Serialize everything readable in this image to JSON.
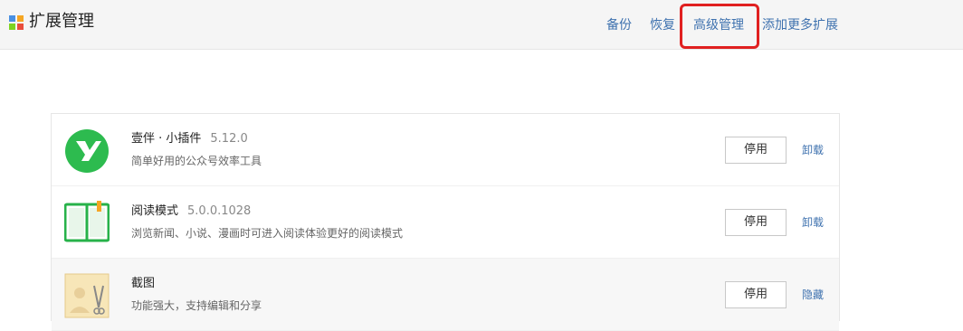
{
  "header": {
    "title": "扩展管理",
    "nav": [
      "备份",
      "恢复",
      "高级管理",
      "添加更多扩展"
    ]
  },
  "extensions": [
    {
      "name": "壹伴 · 小插件",
      "version": "5.12.0",
      "description": "简单好用的公众号效率工具",
      "toggle_label": "停用",
      "action_label": "卸载",
      "icon": "yiban-logo-icon"
    },
    {
      "name": "阅读模式",
      "version": "5.0.0.1028",
      "description": "浏览新闻、小说、漫画时可进入阅读体验更好的阅读模式",
      "toggle_label": "停用",
      "action_label": "卸载",
      "icon": "book-icon"
    },
    {
      "name": "截图",
      "version": "",
      "description": "功能强大，支持编辑和分享",
      "toggle_label": "停用",
      "action_label": "隐藏",
      "icon": "screenshot-icon"
    }
  ],
  "colors": {
    "link": "#3f72af",
    "highlight": "#e02020",
    "yiban_green": "#2dbb4f",
    "book_green": "#27b24a"
  }
}
